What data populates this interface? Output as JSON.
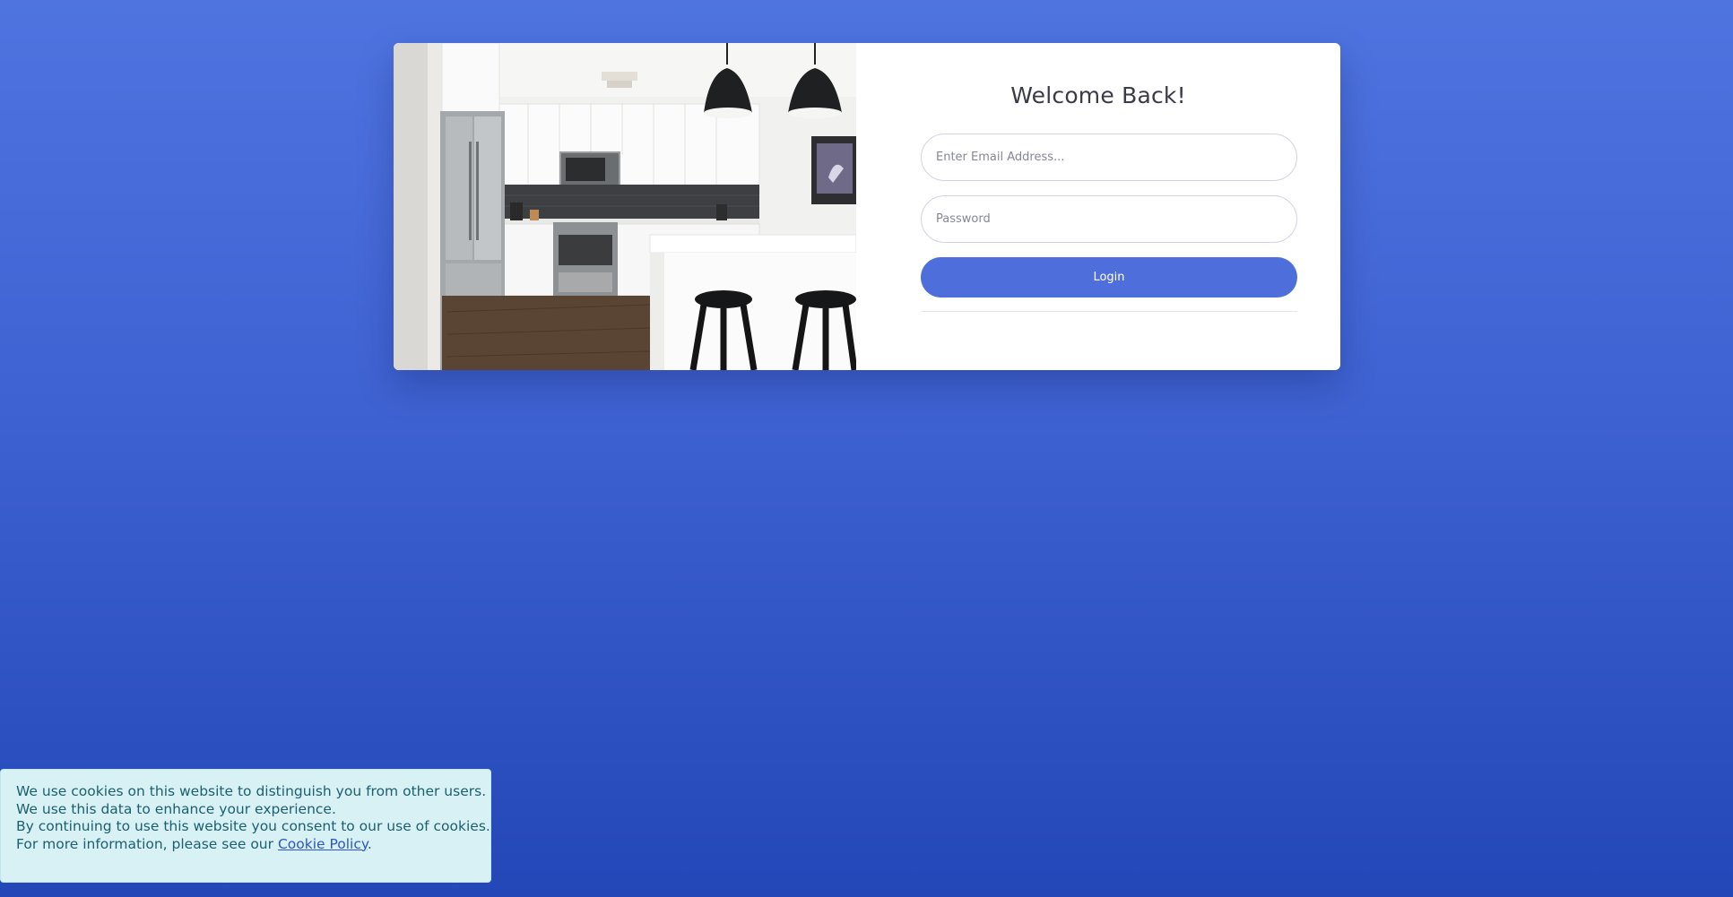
{
  "login": {
    "title": "Welcome Back!",
    "email_placeholder": "Enter Email Address...",
    "password_placeholder": "Password",
    "login_label": "Login"
  },
  "photo": {
    "subject": "kitchen-interior-photo"
  },
  "cookie": {
    "line1": "We use cookies on this website to distinguish you from other users.",
    "line2": "We use this data to enhance your experience.",
    "line3": "By continuing to use this website you consent to our use of cookies.",
    "line4_prefix": "For more information, please see our ",
    "link_text": "Cookie Policy",
    "line4_suffix": "."
  },
  "colors": {
    "background_top": "#4f74e0",
    "background_bottom": "#2447b8",
    "button": "#4e6fdb",
    "cookie_background": "#d7f1f5",
    "cookie_text": "#1c5f6e"
  }
}
